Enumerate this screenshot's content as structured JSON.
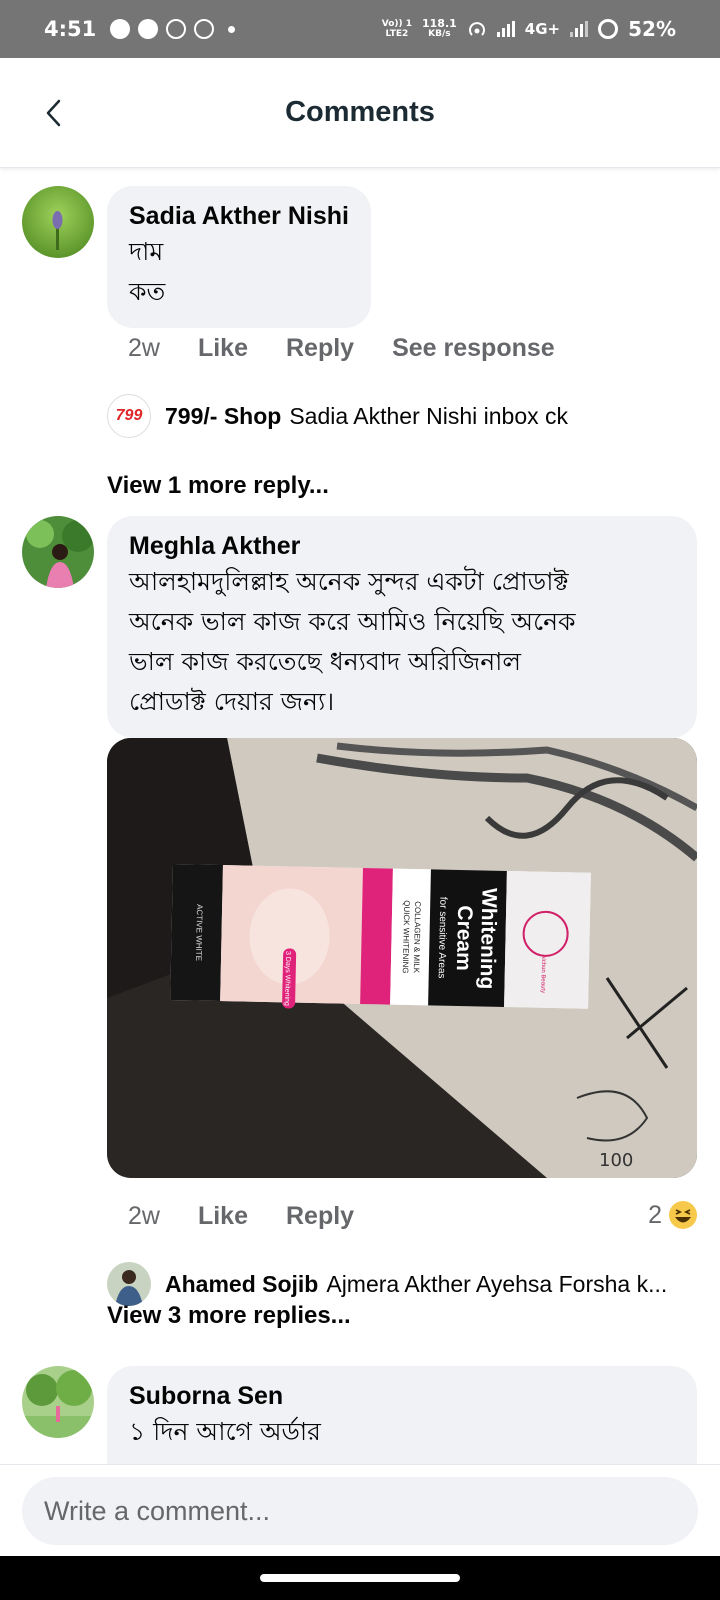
{
  "status_bar": {
    "time": "4:51",
    "network_top": "Vo)) 1",
    "network_bottom": "LTE2",
    "speed_top": "118.1",
    "speed_bottom": "KB/s",
    "network_type": "4G+",
    "battery": "52%"
  },
  "header": {
    "title": "Comments"
  },
  "comments": [
    {
      "author": "Sadia Akther Nishi",
      "text_lines": [
        "দাম",
        "কত"
      ],
      "time": "2w",
      "like": "Like",
      "reply": "Reply",
      "see_response": "See response",
      "reply_preview": {
        "author": "799/-  Shop",
        "avatar_text": "799",
        "text": "Sadia Akther Nishi inbox ck"
      },
      "more_replies": "View 1 more reply..."
    },
    {
      "author": "Meghla Akther",
      "text_lines": [
        "আলহামদুলিল্লাহ অনেক সুন্দর একটা প্রোডাক্ট",
        "অনেক ভাল কাজ করে আমিও নিয়েছি অনেক",
        "ভাল কাজ করতেছে ধন্যবাদ অরিজিনাল",
        "প্রোডাক্ট দেয়ার জন্য।"
      ],
      "photo": {
        "product_name_1": "Whitening",
        "product_name_2": "Cream",
        "subtitle": "for sensitive Areas",
        "line_a": "COLLAGEN & MILK",
        "line_b": "QUICK WHITENING",
        "badge": "3 Days Whitening",
        "line_c": "ACTIVE WHITE",
        "brand": "Aichun Beauty",
        "handwriting": "100"
      },
      "time": "2w",
      "like": "Like",
      "reply": "Reply",
      "reaction_count": "2",
      "reply_preview": {
        "author": "Ahamed Sojib",
        "text": "Ajmera Akther Ayehsa Forsha k..."
      },
      "more_replies": "View 3 more replies..."
    },
    {
      "author": "Suborna Sen",
      "text_lines": [
        "১ দিন আগে অর্ডার"
      ]
    }
  ],
  "composer": {
    "placeholder": "Write a comment..."
  },
  "colors": {
    "bubble": "#f0f2f5",
    "secondary_text": "#65676b",
    "status_bar": "#757575"
  }
}
